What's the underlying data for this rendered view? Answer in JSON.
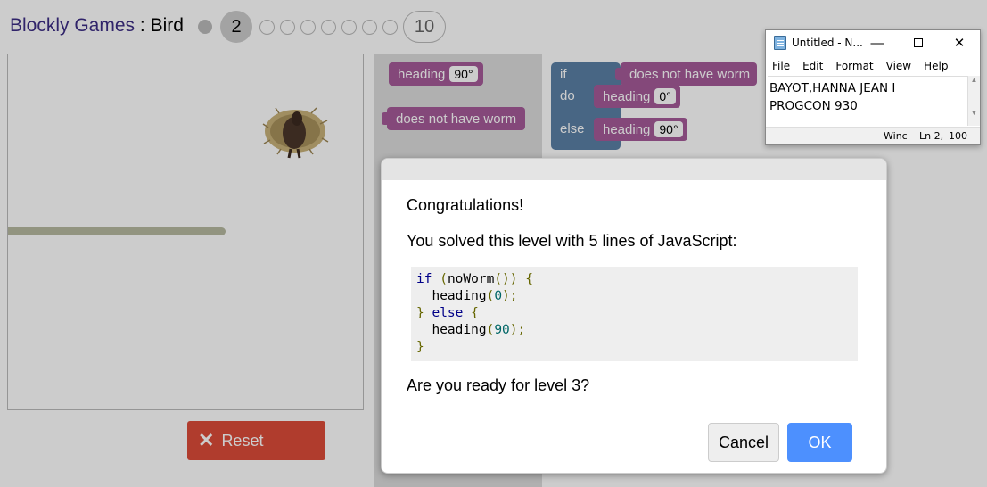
{
  "header": {
    "app_name": "Blockly Games",
    "separator": " : ",
    "game_name": "Bird",
    "current_level": "2",
    "last_level": "10"
  },
  "reset_button": {
    "label": "Reset",
    "icon": "x-icon"
  },
  "toolbox": {
    "heading_block": {
      "label": "heading",
      "value": "90°"
    },
    "condition_block": {
      "label": "does not have worm"
    }
  },
  "workspace": {
    "if_label": "if",
    "do_label": "do",
    "else_label": "else",
    "condition_label": "does not have worm",
    "do_heading": {
      "label": "heading",
      "value": "0°"
    },
    "else_heading": {
      "label": "heading",
      "value": "90°"
    }
  },
  "dialog": {
    "title": "Congratulations!",
    "message": "You solved this level with 5 lines of JavaScript:",
    "code": [
      {
        "kw": "if",
        "rest1": " (",
        "fn": "noWorm",
        "rest2": "()) {"
      },
      {
        "indent": "  ",
        "fn": "heading",
        "open": "(",
        "num": "0",
        "close": ");"
      },
      {
        "brace": "}",
        "kw": " else ",
        "open": "{"
      },
      {
        "indent": "  ",
        "fn": "heading",
        "open": "(",
        "num": "90",
        "close": ");"
      },
      {
        "brace": "}"
      }
    ],
    "question": "Are you ready for level 3?",
    "cancel_label": "Cancel",
    "ok_label": "OK"
  },
  "notepad": {
    "title": "Untitled - N...",
    "menu": [
      "File",
      "Edit",
      "Format",
      "View",
      "Help"
    ],
    "text_lines": [
      "BAYOT,HANNA JEAN I",
      "PROGCON 930"
    ],
    "status": {
      "eol": "Winc",
      "position": "Ln 2,",
      "zoom": "100"
    }
  },
  "colors": {
    "app_title": "#3d2d85",
    "reset": "#dd4b39",
    "heading_block": "#a55b99",
    "if_block": "#5b80a5",
    "ok_button": "#4d90fe"
  }
}
